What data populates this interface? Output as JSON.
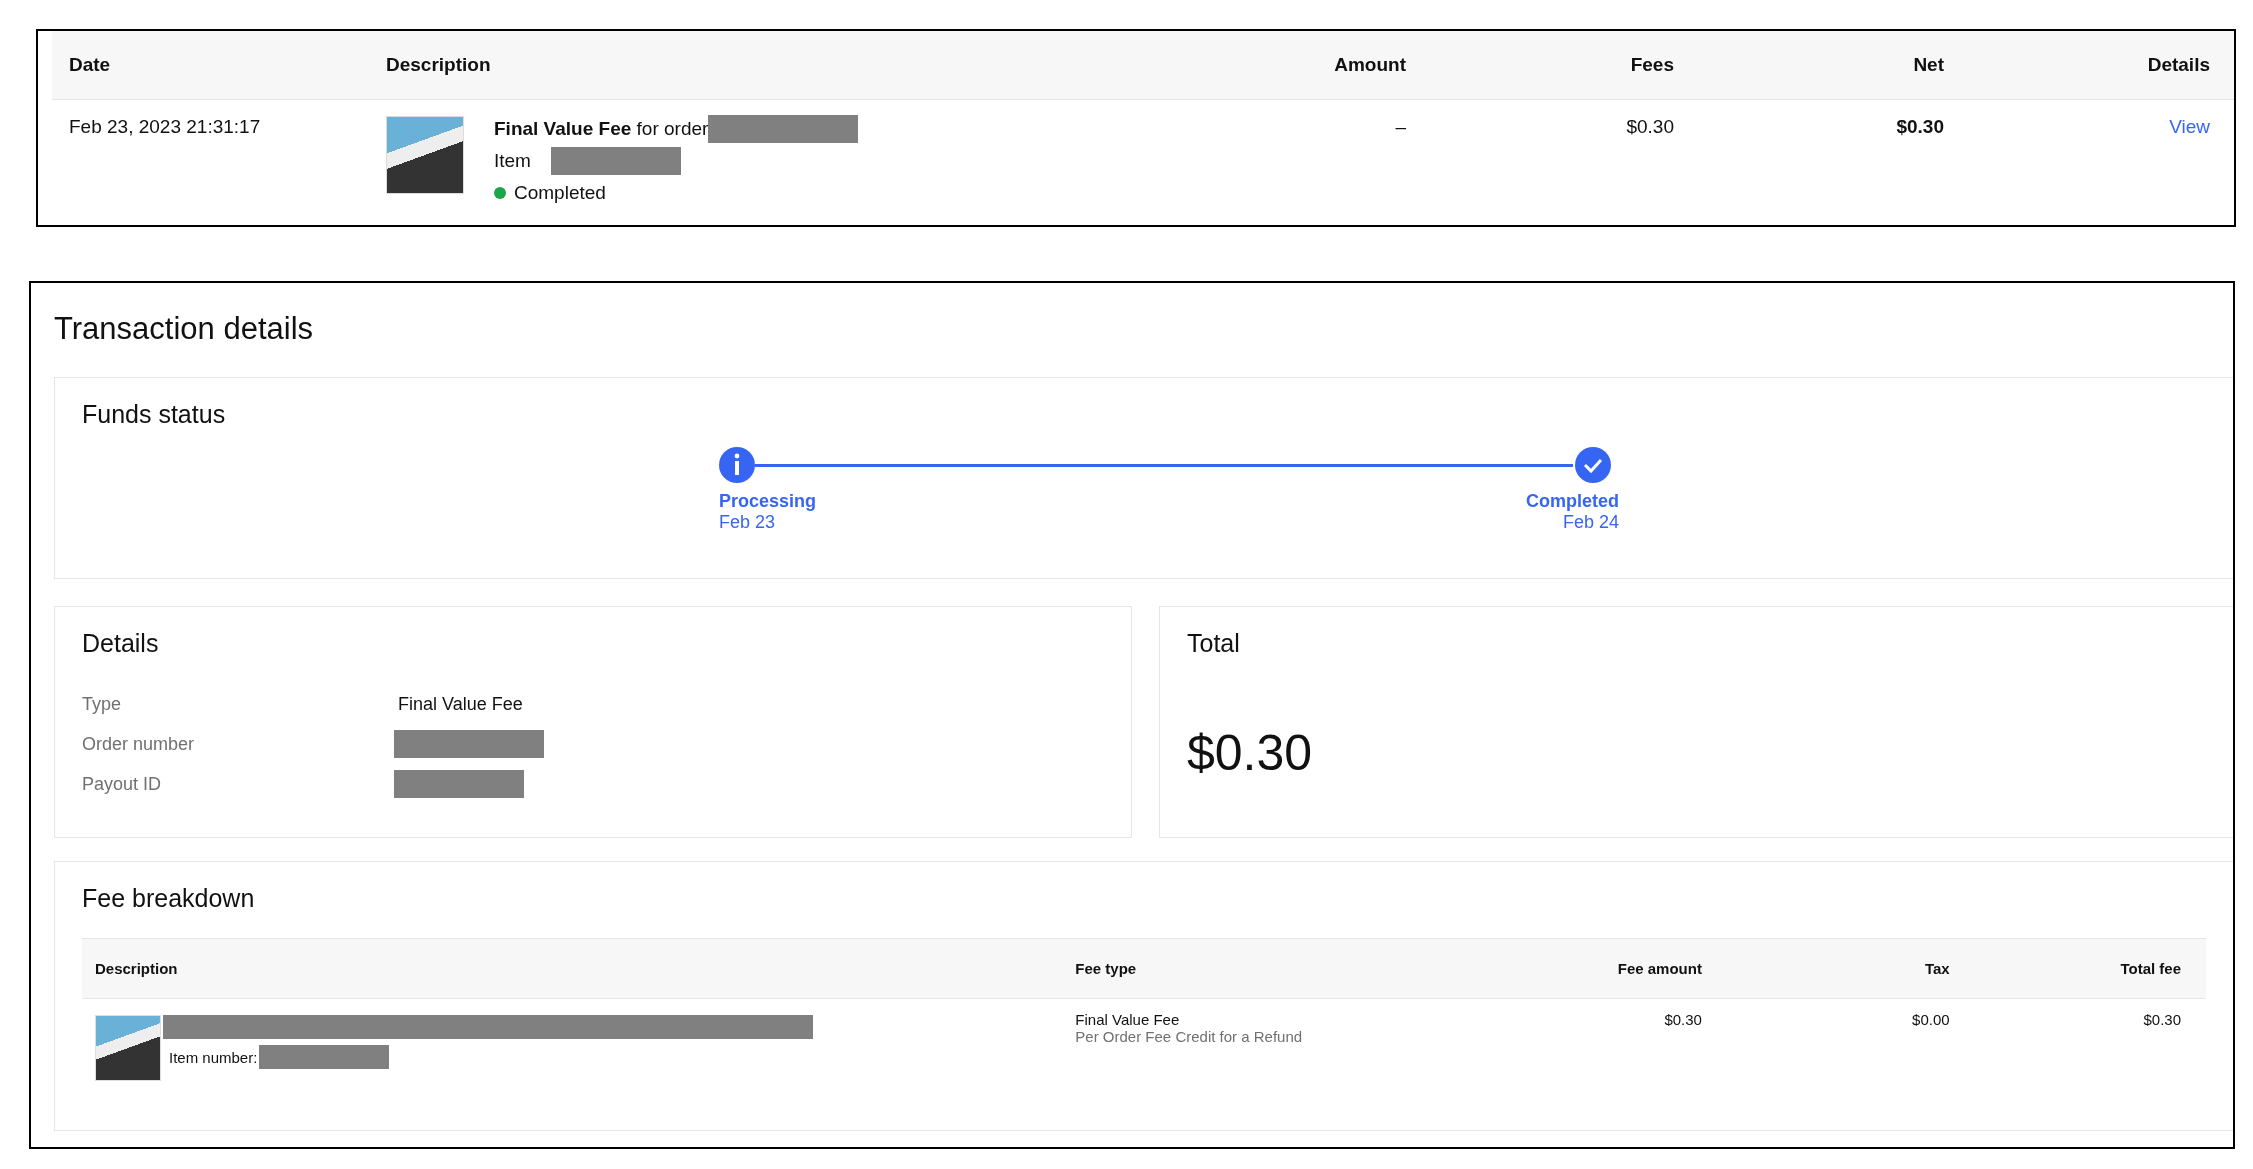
{
  "transactions": {
    "columns": [
      "Date",
      "Description",
      "Amount",
      "Fees",
      "Net",
      "Details"
    ],
    "rows": [
      {
        "date": "Feb 23, 2023 21:31:17",
        "title": "**Final Value Fee** for order",
        "item_label": "Item",
        "status": "Completed",
        "color": "#1ea54a",
        "amount": "–",
        "fees": "$0.30",
        "net": "$0.30",
        "details_link": "View"
      }
    ]
  },
  "details_panel": {
    "title": "Transaction details",
    "funds_status": {
      "title": "Funds status",
      "steps": [
        {
          "kind": "info",
          "label": "Processing",
          "date": "Feb 23"
        },
        {
          "kind": "check",
          "label": "Completed",
          "date": "Feb 24"
        }
      ]
    },
    "details": {
      "title": "Details",
      "fields": [
        {
          "label": "Type",
          "value": "Final Value Fee",
          "redacted": false
        },
        {
          "label": "Order number",
          "redacted": true
        },
        {
          "label": "Payout ID",
          "redacted": true
        }
      ]
    },
    "total": {
      "title": "Total",
      "amount": "$0.30"
    },
    "fee_breakdown": {
      "title": "Fee breakdown",
      "columns": [
        "Description",
        "Fee type",
        "Fee amount",
        "Tax",
        "Total fee"
      ],
      "rows": [
        {
          "item_number_label": "Item number:",
          "fee_type": "Final Value Fee",
          "fee_note": "Per Order Fee Credit for a Refund",
          "fee_amount": "$0.30",
          "tax": "$0.00",
          "total_fee": "$0.30"
        }
      ]
    }
  }
}
